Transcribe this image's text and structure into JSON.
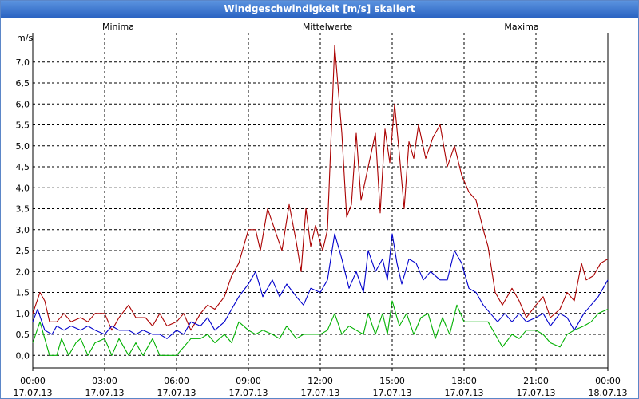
{
  "window": {
    "title": "Windgeschwindigkeit [m/s] skaliert"
  },
  "colors": {
    "minima": "#00b000",
    "mittel": "#0000cc",
    "maxima": "#aa0000",
    "grid": "#000000"
  },
  "chart_data": {
    "type": "line",
    "title": "Windgeschwindigkeit [m/s] skaliert",
    "ylabel": "m/s",
    "ylim": [
      -0.3,
      7.7
    ],
    "yticks": [
      0.0,
      0.5,
      1.0,
      1.5,
      2.0,
      2.5,
      3.0,
      3.5,
      4.0,
      4.5,
      5.0,
      5.5,
      6.0,
      6.5,
      7.0
    ],
    "ytick_labels": [
      "0,0",
      "0,5",
      "1,0",
      "1,5",
      "2,0",
      "2,5",
      "3,0",
      "3,5",
      "4,0",
      "4,5",
      "5,0",
      "5,5",
      "6,0",
      "6,5",
      "7,0"
    ],
    "xlim_hours": [
      0,
      24
    ],
    "xticks": [
      {
        "hour": 0,
        "time": "00:00",
        "date": "17.07.13"
      },
      {
        "hour": 3,
        "time": "03:00",
        "date": "17.07.13"
      },
      {
        "hour": 6,
        "time": "06:00",
        "date": "17.07.13"
      },
      {
        "hour": 9,
        "time": "09:00",
        "date": "17.07.13"
      },
      {
        "hour": 12,
        "time": "12:00",
        "date": "17.07.13"
      },
      {
        "hour": 15,
        "time": "15:00",
        "date": "17.07.13"
      },
      {
        "hour": 18,
        "time": "18:00",
        "date": "17.07.13"
      },
      {
        "hour": 21,
        "time": "21:00",
        "date": "17.07.13"
      },
      {
        "hour": 24,
        "time": "00:00",
        "date": "18.07.13"
      }
    ],
    "legend": [
      "Minima",
      "Mittelwerte",
      "Maxima"
    ],
    "grid": true,
    "series": [
      {
        "name": "Maxima",
        "color": "#aa0000",
        "points": [
          [
            0,
            1.0
          ],
          [
            0.3,
            1.5
          ],
          [
            0.5,
            1.3
          ],
          [
            0.7,
            0.8
          ],
          [
            1,
            0.8
          ],
          [
            1.3,
            1.0
          ],
          [
            1.6,
            0.8
          ],
          [
            2,
            0.9
          ],
          [
            2.3,
            0.8
          ],
          [
            2.6,
            1.0
          ],
          [
            3,
            1.0
          ],
          [
            3.3,
            0.6
          ],
          [
            3.6,
            0.9
          ],
          [
            4,
            1.2
          ],
          [
            4.3,
            0.9
          ],
          [
            4.7,
            0.9
          ],
          [
            5,
            0.7
          ],
          [
            5.3,
            1.0
          ],
          [
            5.6,
            0.7
          ],
          [
            6,
            0.8
          ],
          [
            6.3,
            1.0
          ],
          [
            6.6,
            0.6
          ],
          [
            7,
            1.0
          ],
          [
            7.3,
            1.2
          ],
          [
            7.6,
            1.1
          ],
          [
            8,
            1.4
          ],
          [
            8.3,
            1.9
          ],
          [
            8.6,
            2.2
          ],
          [
            9,
            3.0
          ],
          [
            9.3,
            3.0
          ],
          [
            9.5,
            2.5
          ],
          [
            9.8,
            3.5
          ],
          [
            10.1,
            3.0
          ],
          [
            10.4,
            2.5
          ],
          [
            10.7,
            3.6
          ],
          [
            11,
            2.7
          ],
          [
            11.2,
            2.0
          ],
          [
            11.4,
            3.5
          ],
          [
            11.6,
            2.6
          ],
          [
            11.8,
            3.1
          ],
          [
            12.1,
            2.5
          ],
          [
            12.3,
            3.0
          ],
          [
            12.6,
            7.4
          ],
          [
            12.9,
            5.3
          ],
          [
            13.1,
            3.3
          ],
          [
            13.3,
            3.6
          ],
          [
            13.5,
            5.3
          ],
          [
            13.7,
            3.7
          ],
          [
            14,
            4.5
          ],
          [
            14.3,
            5.3
          ],
          [
            14.5,
            3.4
          ],
          [
            14.7,
            5.4
          ],
          [
            14.9,
            4.6
          ],
          [
            15.1,
            6.0
          ],
          [
            15.3,
            4.8
          ],
          [
            15.5,
            3.5
          ],
          [
            15.7,
            5.1
          ],
          [
            15.9,
            4.7
          ],
          [
            16.1,
            5.5
          ],
          [
            16.4,
            4.7
          ],
          [
            16.7,
            5.2
          ],
          [
            17,
            5.5
          ],
          [
            17.3,
            4.5
          ],
          [
            17.6,
            5.0
          ],
          [
            17.9,
            4.3
          ],
          [
            18.2,
            3.9
          ],
          [
            18.5,
            3.7
          ],
          [
            18.8,
            3.0
          ],
          [
            19,
            2.6
          ],
          [
            19.3,
            1.5
          ],
          [
            19.6,
            1.2
          ],
          [
            20,
            1.6
          ],
          [
            20.3,
            1.3
          ],
          [
            20.6,
            0.9
          ],
          [
            21,
            1.2
          ],
          [
            21.3,
            1.4
          ],
          [
            21.6,
            0.9
          ],
          [
            22,
            1.1
          ],
          [
            22.3,
            1.5
          ],
          [
            22.6,
            1.3
          ],
          [
            22.9,
            2.2
          ],
          [
            23.1,
            1.8
          ],
          [
            23.4,
            1.9
          ],
          [
            23.7,
            2.2
          ],
          [
            24,
            2.3
          ]
        ]
      },
      {
        "name": "Mittelwerte",
        "color": "#0000cc",
        "points": [
          [
            0,
            0.8
          ],
          [
            0.2,
            1.1
          ],
          [
            0.5,
            0.6
          ],
          [
            0.8,
            0.5
          ],
          [
            1,
            0.7
          ],
          [
            1.3,
            0.6
          ],
          [
            1.6,
            0.7
          ],
          [
            2,
            0.6
          ],
          [
            2.3,
            0.7
          ],
          [
            2.6,
            0.6
          ],
          [
            3,
            0.5
          ],
          [
            3.3,
            0.7
          ],
          [
            3.6,
            0.6
          ],
          [
            4,
            0.6
          ],
          [
            4.3,
            0.5
          ],
          [
            4.6,
            0.6
          ],
          [
            5,
            0.5
          ],
          [
            5.3,
            0.5
          ],
          [
            5.6,
            0.4
          ],
          [
            6,
            0.6
          ],
          [
            6.3,
            0.5
          ],
          [
            6.6,
            0.8
          ],
          [
            7,
            0.7
          ],
          [
            7.3,
            0.9
          ],
          [
            7.6,
            0.6
          ],
          [
            8,
            0.8
          ],
          [
            8.3,
            1.1
          ],
          [
            8.6,
            1.4
          ],
          [
            9,
            1.7
          ],
          [
            9.3,
            2.0
          ],
          [
            9.6,
            1.4
          ],
          [
            10,
            1.8
          ],
          [
            10.3,
            1.4
          ],
          [
            10.6,
            1.7
          ],
          [
            11,
            1.4
          ],
          [
            11.3,
            1.2
          ],
          [
            11.6,
            1.6
          ],
          [
            12,
            1.5
          ],
          [
            12.3,
            1.8
          ],
          [
            12.6,
            2.9
          ],
          [
            12.9,
            2.3
          ],
          [
            13.2,
            1.6
          ],
          [
            13.5,
            2.0
          ],
          [
            13.8,
            1.5
          ],
          [
            14,
            2.5
          ],
          [
            14.3,
            2.0
          ],
          [
            14.6,
            2.3
          ],
          [
            14.8,
            1.8
          ],
          [
            15,
            2.9
          ],
          [
            15.2,
            2.2
          ],
          [
            15.4,
            1.7
          ],
          [
            15.7,
            2.3
          ],
          [
            16,
            2.2
          ],
          [
            16.3,
            1.8
          ],
          [
            16.6,
            2.0
          ],
          [
            17,
            1.8
          ],
          [
            17.3,
            1.8
          ],
          [
            17.6,
            2.5
          ],
          [
            17.9,
            2.2
          ],
          [
            18.2,
            1.6
          ],
          [
            18.5,
            1.5
          ],
          [
            18.8,
            1.2
          ],
          [
            19.1,
            1.0
          ],
          [
            19.4,
            0.8
          ],
          [
            19.7,
            1.0
          ],
          [
            20,
            0.8
          ],
          [
            20.3,
            1.0
          ],
          [
            20.6,
            0.8
          ],
          [
            21,
            0.9
          ],
          [
            21.3,
            1.0
          ],
          [
            21.6,
            0.7
          ],
          [
            22,
            1.0
          ],
          [
            22.3,
            0.9
          ],
          [
            22.6,
            0.6
          ],
          [
            23,
            1.0
          ],
          [
            23.3,
            1.2
          ],
          [
            23.6,
            1.4
          ],
          [
            24,
            1.8
          ]
        ]
      },
      {
        "name": "Minima",
        "color": "#00b000",
        "points": [
          [
            0,
            0.3
          ],
          [
            0.3,
            0.8
          ],
          [
            0.5,
            0.4
          ],
          [
            0.7,
            0.0
          ],
          [
            1,
            0.0
          ],
          [
            1.2,
            0.4
          ],
          [
            1.5,
            0.0
          ],
          [
            1.8,
            0.3
          ],
          [
            2,
            0.4
          ],
          [
            2.3,
            0.0
          ],
          [
            2.6,
            0.3
          ],
          [
            3,
            0.4
          ],
          [
            3.3,
            0.0
          ],
          [
            3.6,
            0.4
          ],
          [
            4,
            0.0
          ],
          [
            4.3,
            0.3
          ],
          [
            4.6,
            0.0
          ],
          [
            5,
            0.4
          ],
          [
            5.3,
            0.0
          ],
          [
            5.6,
            0.0
          ],
          [
            6,
            0.0
          ],
          [
            6.3,
            0.2
          ],
          [
            6.6,
            0.4
          ],
          [
            7,
            0.4
          ],
          [
            7.3,
            0.5
          ],
          [
            7.6,
            0.3
          ],
          [
            8,
            0.5
          ],
          [
            8.3,
            0.3
          ],
          [
            8.6,
            0.8
          ],
          [
            9,
            0.6
          ],
          [
            9.3,
            0.5
          ],
          [
            9.6,
            0.6
          ],
          [
            10,
            0.5
          ],
          [
            10.3,
            0.4
          ],
          [
            10.6,
            0.7
          ],
          [
            11,
            0.4
          ],
          [
            11.3,
            0.5
          ],
          [
            11.6,
            0.5
          ],
          [
            12,
            0.5
          ],
          [
            12.3,
            0.6
          ],
          [
            12.6,
            1.0
          ],
          [
            12.9,
            0.5
          ],
          [
            13.2,
            0.7
          ],
          [
            13.5,
            0.6
          ],
          [
            13.8,
            0.5
          ],
          [
            14,
            1.0
          ],
          [
            14.3,
            0.5
          ],
          [
            14.6,
            1.0
          ],
          [
            14.8,
            0.5
          ],
          [
            15,
            1.3
          ],
          [
            15.3,
            0.7
          ],
          [
            15.6,
            1.0
          ],
          [
            15.9,
            0.5
          ],
          [
            16.2,
            0.9
          ],
          [
            16.5,
            1.0
          ],
          [
            16.8,
            0.4
          ],
          [
            17.1,
            0.9
          ],
          [
            17.4,
            0.5
          ],
          [
            17.7,
            1.2
          ],
          [
            18,
            0.8
          ],
          [
            18.3,
            0.8
          ],
          [
            18.6,
            0.8
          ],
          [
            19,
            0.8
          ],
          [
            19.3,
            0.5
          ],
          [
            19.6,
            0.2
          ],
          [
            20,
            0.5
          ],
          [
            20.3,
            0.4
          ],
          [
            20.6,
            0.6
          ],
          [
            21,
            0.6
          ],
          [
            21.3,
            0.5
          ],
          [
            21.6,
            0.3
          ],
          [
            22,
            0.2
          ],
          [
            22.3,
            0.5
          ],
          [
            22.6,
            0.6
          ],
          [
            23,
            0.7
          ],
          [
            23.3,
            0.8
          ],
          [
            23.6,
            1.0
          ],
          [
            24,
            1.1
          ]
        ]
      }
    ]
  }
}
